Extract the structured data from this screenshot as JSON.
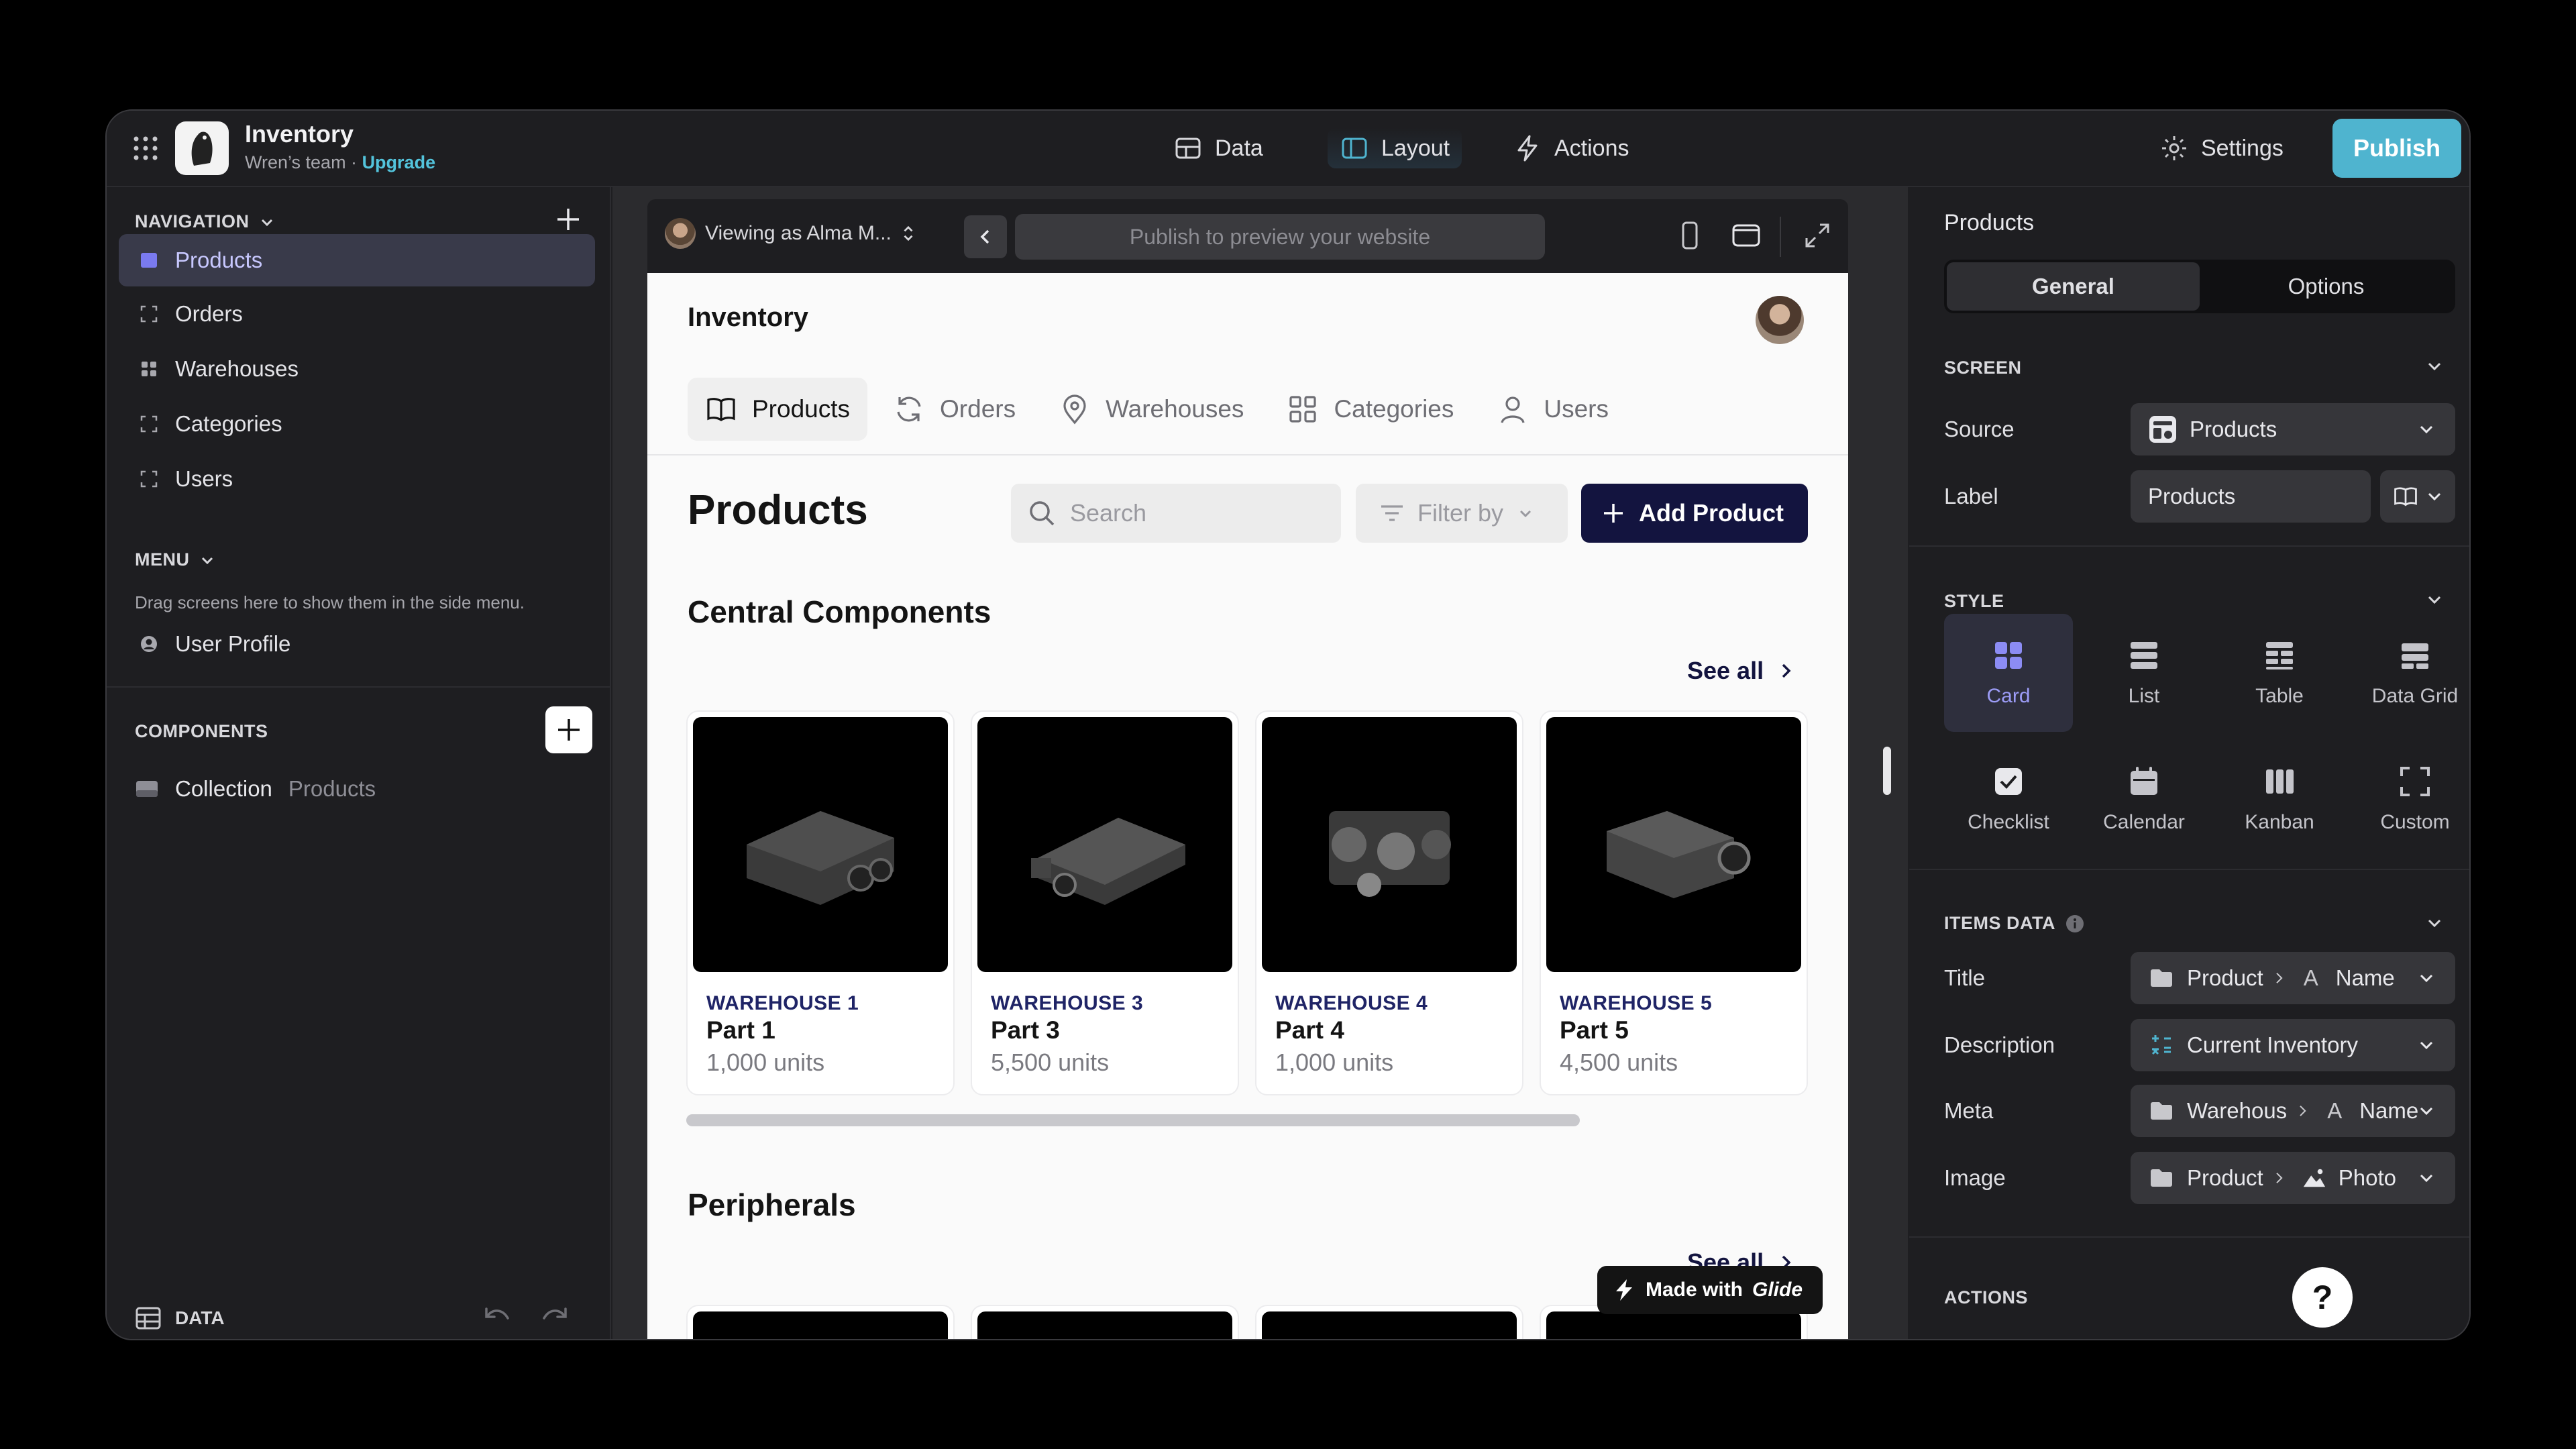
{
  "topbar": {
    "app_name": "Inventory",
    "team": "Wren’s team · ",
    "upgrade": "Upgrade",
    "nav": [
      {
        "label": "Data",
        "icon": "table-icon"
      },
      {
        "label": "Layout",
        "icon": "layout-icon",
        "active": true
      },
      {
        "label": "Actions",
        "icon": "bolt-icon"
      }
    ],
    "settings": "Settings",
    "publish": "Publish"
  },
  "left": {
    "navigation_head": "NAVIGATION",
    "nav_items": [
      {
        "label": "Products",
        "active": true
      },
      {
        "label": "Orders"
      },
      {
        "label": "Warehouses"
      },
      {
        "label": "Categories"
      },
      {
        "label": "Users"
      }
    ],
    "menu_head": "MENU",
    "menu_hint": "Drag screens here to show them in the side menu.",
    "menu_item": "User Profile",
    "components_head": "COMPONENTS",
    "component": {
      "name": "Collection",
      "source": "Products"
    },
    "data_label": "DATA"
  },
  "preview": {
    "viewing_as": "Viewing as Alma M...",
    "url_placeholder": "Publish to preview your website",
    "app_title": "Inventory",
    "tabs": [
      {
        "label": "Products",
        "active": true
      },
      {
        "label": "Orders"
      },
      {
        "label": "Warehouses"
      },
      {
        "label": "Categories"
      },
      {
        "label": "Users"
      }
    ],
    "page_title": "Products",
    "search_placeholder": "Search",
    "filter_label": "Filter by",
    "add_button": "Add Product",
    "section1": "Central Components",
    "section2": "Peripherals",
    "see_all": "See all",
    "cards": [
      {
        "meta": "WAREHOUSE 1",
        "title": "Part 1",
        "desc": "1,000 units"
      },
      {
        "meta": "WAREHOUSE 3",
        "title": "Part 3",
        "desc": "5,500 units"
      },
      {
        "meta": "WAREHOUSE 4",
        "title": "Part 4",
        "desc": "1,000 units"
      },
      {
        "meta": "WAREHOUSE 5",
        "title": "Part 5",
        "desc": "4,500 units"
      }
    ],
    "made_with": "Made with",
    "glide": "Glide"
  },
  "right": {
    "title": "Products",
    "tabs": [
      {
        "label": "General",
        "active": true
      },
      {
        "label": "Options"
      }
    ],
    "screen_head": "SCREEN",
    "source_label": "Source",
    "source_value": "Products",
    "label_label": "Label",
    "label_value": "Products",
    "style_head": "STYLE",
    "styles": [
      {
        "label": "Card",
        "active": true
      },
      {
        "label": "List"
      },
      {
        "label": "Table"
      },
      {
        "label": "Data Grid"
      },
      {
        "label": "Checklist"
      },
      {
        "label": "Calendar"
      },
      {
        "label": "Kanban"
      },
      {
        "label": "Custom"
      }
    ],
    "items_head": "ITEMS DATA",
    "items": [
      {
        "label": "Title",
        "path": "Product",
        "kind": "A",
        "value": "Name"
      },
      {
        "label": "Description",
        "value": "Current Inventory"
      },
      {
        "label": "Meta",
        "path": "Warehous",
        "kind": "A",
        "value": "Name"
      },
      {
        "label": "Image",
        "path": "Product",
        "value": "Photo"
      }
    ],
    "actions_head": "ACTIONS"
  },
  "help": "?"
}
